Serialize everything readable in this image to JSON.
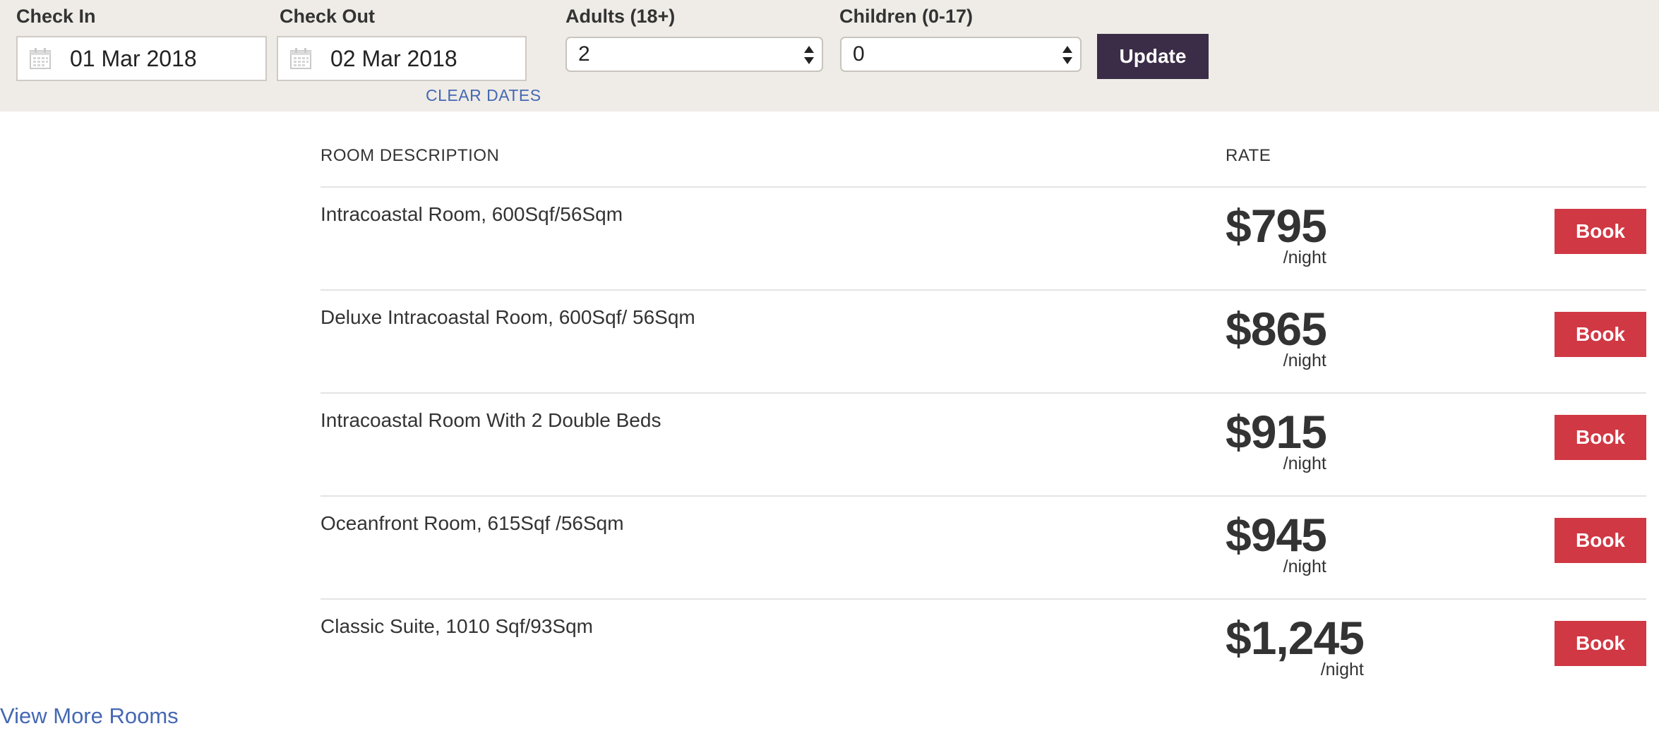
{
  "search": {
    "check_in": {
      "label": "Check In",
      "value": "01 Mar 2018"
    },
    "check_out": {
      "label": "Check Out",
      "value": "02 Mar 2018"
    },
    "clear_dates_label": "CLEAR DATES",
    "adults": {
      "label": "Adults (18+)",
      "value": "2"
    },
    "children": {
      "label": "Children (0-17)",
      "value": "0"
    },
    "update_label": "Update"
  },
  "table": {
    "headers": {
      "description": "ROOM DESCRIPTION",
      "rate": "RATE"
    },
    "rooms": [
      {
        "name": "Intracoastal Room, 600Sqf/56Sqm",
        "price": "$795",
        "unit": "/night",
        "book_label": "Book"
      },
      {
        "name": "Deluxe Intracoastal Room, 600Sqf/ 56Sqm",
        "price": "$865",
        "unit": "/night",
        "book_label": "Book"
      },
      {
        "name": "Intracoastal Room With 2 Double Beds",
        "price": "$915",
        "unit": "/night",
        "book_label": "Book"
      },
      {
        "name": "Oceanfront Room, 615Sqf /56Sqm",
        "price": "$945",
        "unit": "/night",
        "book_label": "Book"
      },
      {
        "name": "Classic Suite, 1010 Sqf/93Sqm",
        "price": "$1,245",
        "unit": "/night",
        "book_label": "Book"
      }
    ]
  },
  "view_more_label": "View More Rooms",
  "colors": {
    "search_bar_bg": "#efece7",
    "update_button": "#3b2d47",
    "book_button": "#d03844",
    "link": "#4568b3"
  },
  "icons": {
    "check_in": "calendar-icon",
    "check_out": "calendar-icon",
    "select_arrows": "select-arrows-icon"
  }
}
